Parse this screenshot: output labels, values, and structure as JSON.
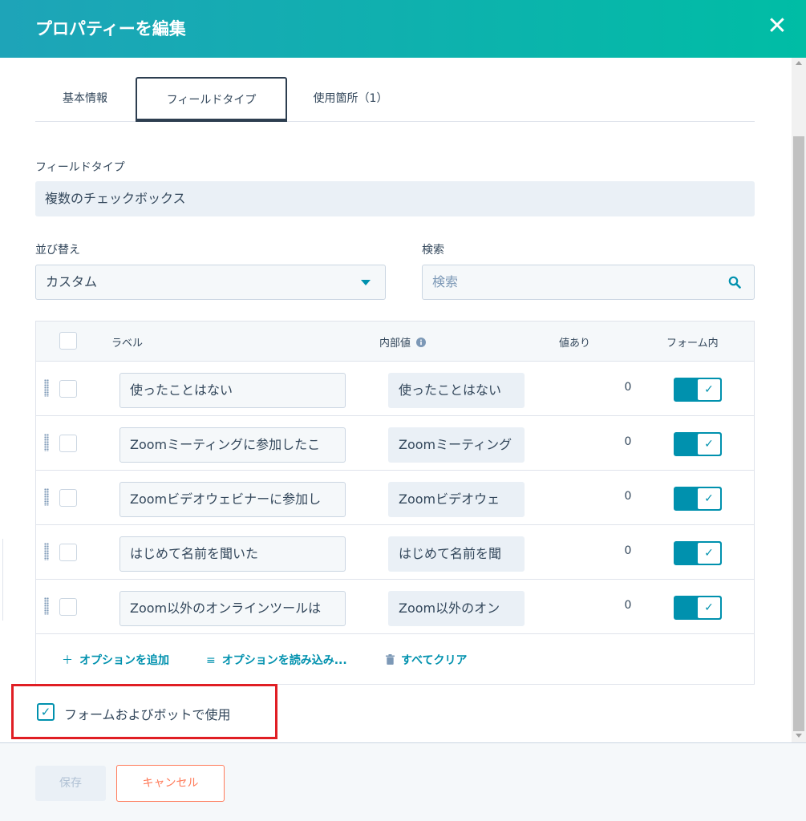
{
  "dialog": {
    "title": "プロパティーを編集",
    "close_glyph": "✕"
  },
  "tabs": [
    {
      "label": "基本情報",
      "active": false
    },
    {
      "label": "フィールドタイプ",
      "active": true
    },
    {
      "label": "使用箇所（1）",
      "active": false
    }
  ],
  "field_type": {
    "label": "フィールドタイプ",
    "value": "複数のチェックボックス"
  },
  "sort": {
    "label": "並び替え",
    "value": "カスタム"
  },
  "search": {
    "label": "検索",
    "placeholder": "検索"
  },
  "table": {
    "headers": {
      "label": "ラベル",
      "internal_value": "内部値",
      "has_value": "値あり",
      "in_form": "フォーム内"
    },
    "rows": [
      {
        "label": "使ったことはない",
        "internal": "使ったことはない",
        "count": "0",
        "in_form": true
      },
      {
        "label": "Zoomミーティングに参加したこ",
        "internal": "Zoomミーティング",
        "count": "0",
        "in_form": true
      },
      {
        "label": "Zoomビデオウェビナーに参加し",
        "internal": "Zoomビデオウェ",
        "count": "0",
        "in_form": true
      },
      {
        "label": "はじめて名前を聞いた",
        "internal": "はじめて名前を聞",
        "count": "0",
        "in_form": true
      },
      {
        "label": "Zoom以外のオンラインツールは",
        "internal": "Zoom以外のオン",
        "count": "0",
        "in_form": true
      }
    ],
    "actions": {
      "add": "オプションを追加",
      "load": "オプションを読み込み...",
      "clear": "すべてクリア"
    }
  },
  "use_in_forms": {
    "label": "フォームおよびボットで使用",
    "checked": true
  },
  "buttons": {
    "save": "保存",
    "cancel": "キャンセル"
  },
  "colors": {
    "header_start": "#1ea4b8",
    "header_end": "#00bda5",
    "accent": "#0091ae",
    "cancel": "#ff7a59",
    "highlight": "#e01e24"
  }
}
